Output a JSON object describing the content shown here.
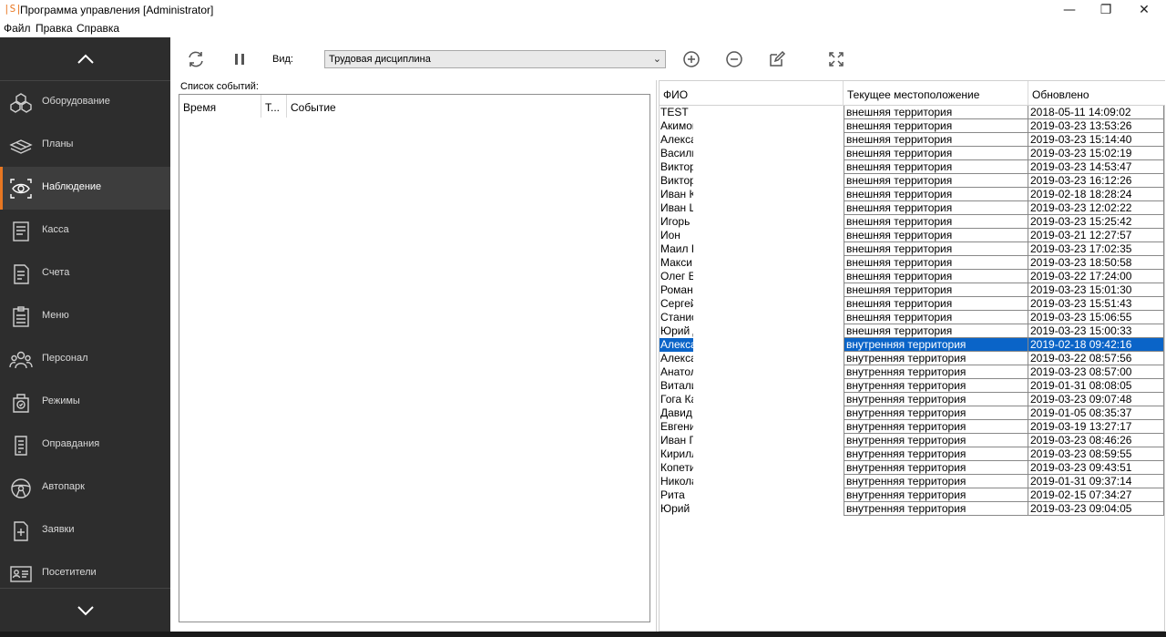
{
  "window": {
    "logo": "|S|",
    "title": "Программа управления [Administrator]",
    "controls": [
      "—",
      "❐",
      "✕"
    ]
  },
  "menu": [
    "Файл",
    "Правка",
    "Справка"
  ],
  "sidebar": {
    "items": [
      {
        "label": "Оборудование",
        "icon": "equipment-icon"
      },
      {
        "label": "Планы",
        "icon": "plans-icon"
      },
      {
        "label": "Наблюдение",
        "icon": "eye-icon",
        "active": true
      },
      {
        "label": "Касса",
        "icon": "cashbox-icon"
      },
      {
        "label": "Счета",
        "icon": "invoice-icon"
      },
      {
        "label": "Меню",
        "icon": "menu-list-icon"
      },
      {
        "label": "Персонал",
        "icon": "staff-icon"
      },
      {
        "label": "Режимы",
        "icon": "modes-icon"
      },
      {
        "label": "Оправдания",
        "icon": "excuses-icon"
      },
      {
        "label": "Автопарк",
        "icon": "steering-wheel-icon"
      },
      {
        "label": "Заявки",
        "icon": "requests-icon"
      },
      {
        "label": "Посетители",
        "icon": "visitors-icon"
      }
    ],
    "accent": "#e87722"
  },
  "toolbar": {
    "view_label": "Вид:",
    "view_value": "Трудовая дисциплина",
    "buttons": [
      "refresh-icon",
      "pause-icon",
      "add-icon",
      "remove-icon",
      "edit-icon",
      "fullscreen-icon"
    ]
  },
  "events": {
    "label": "Список событий:",
    "columns": [
      "Время",
      "Т...",
      "Событие"
    ]
  },
  "grid": {
    "columns": [
      "ФИО",
      "Текущее местоположение",
      "Обновлено"
    ],
    "rows": [
      {
        "name": "TEST",
        "location": "внешняя территория",
        "updated": "2018-05-11 14:09:02"
      },
      {
        "name": "Акимов",
        "location": "внешняя территория",
        "updated": "2019-03-23 13:53:26"
      },
      {
        "name": "Алекса",
        "location": "внешняя территория",
        "updated": "2019-03-23 15:14:40"
      },
      {
        "name": "Васили",
        "location": "внешняя территория",
        "updated": "2019-03-23 15:02:19"
      },
      {
        "name": "Виктор",
        "location": "внешняя территория",
        "updated": "2019-03-23 14:53:47"
      },
      {
        "name": "Виктор",
        "location": "внешняя территория",
        "updated": "2019-03-23 16:12:26"
      },
      {
        "name": "Иван К",
        "location": "внешняя территория",
        "updated": "2019-02-18 18:28:24"
      },
      {
        "name": "Иван L",
        "location": "внешняя территория",
        "updated": "2019-03-23 12:02:22"
      },
      {
        "name": "Игорь",
        "location": "внешняя территория",
        "updated": "2019-03-23 15:25:42"
      },
      {
        "name": "Ион",
        "location": "внешняя территория",
        "updated": "2019-03-21 12:27:57"
      },
      {
        "name": "Маил К",
        "location": "внешняя территория",
        "updated": "2019-03-23 17:02:35"
      },
      {
        "name": "Макси",
        "location": "внешняя территория",
        "updated": "2019-03-23 18:50:58"
      },
      {
        "name": "Олег Б",
        "location": "внешняя территория",
        "updated": "2019-03-22 17:24:00"
      },
      {
        "name": "Роман",
        "location": "внешняя территория",
        "updated": "2019-03-23 15:01:30"
      },
      {
        "name": "Сергей",
        "location": "внешняя территория",
        "updated": "2019-03-23 15:51:43"
      },
      {
        "name": "Станис",
        "location": "внешняя территория",
        "updated": "2019-03-23 15:06:55"
      },
      {
        "name": "Юрий Д",
        "location": "внешняя территория",
        "updated": "2019-03-23 15:00:33"
      },
      {
        "name": "Алекса",
        "location": "внутренняя территория",
        "updated": "2019-02-18 09:42:16",
        "selected": true
      },
      {
        "name": "Алекса",
        "location": "внутренняя территория",
        "updated": "2019-03-22 08:57:56"
      },
      {
        "name": "Анатол",
        "location": "внутренняя территория",
        "updated": "2019-03-23 08:57:00"
      },
      {
        "name": "Витали",
        "location": "внутренняя территория",
        "updated": "2019-01-31 08:08:05"
      },
      {
        "name": "Гога Ка",
        "location": "внутренняя территория",
        "updated": "2019-03-23 09:07:48"
      },
      {
        "name": "Давид",
        "location": "внутренняя территория",
        "updated": "2019-01-05 08:35:37"
      },
      {
        "name": "Евгени",
        "location": "внутренняя территория",
        "updated": "2019-03-19 13:27:17"
      },
      {
        "name": "Иван Г",
        "location": "внутренняя территория",
        "updated": "2019-03-23 08:46:26"
      },
      {
        "name": "Кирилл",
        "location": "внутренняя территория",
        "updated": "2019-03-23 08:59:55"
      },
      {
        "name": "Копети",
        "location": "внутренняя территория",
        "updated": "2019-03-23 09:43:51"
      },
      {
        "name": "Никола",
        "location": "внутренняя территория",
        "updated": "2019-01-31 09:37:14"
      },
      {
        "name": "Рита",
        "location": "внутренняя территория",
        "updated": "2019-02-15 07:34:27"
      },
      {
        "name": "Юрий I",
        "location": "внутренняя территория",
        "updated": "2019-03-23 09:04:05"
      }
    ],
    "selection_color": "#0a64c8"
  }
}
